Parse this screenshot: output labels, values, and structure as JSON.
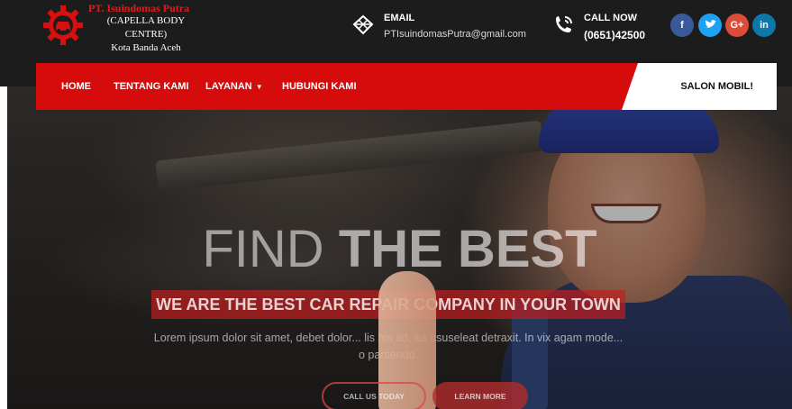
{
  "brand": {
    "name": "PT. Isuindomas Putra",
    "subtitle": "(CAPELLA BODY CENTRE)",
    "city": "Kota Banda Aceh"
  },
  "contact": {
    "email_label": "EMAIL",
    "email_value": "PTIsuindomasPutra@gmail.com",
    "phone_label": "CALL NOW",
    "phone_value": "(0651)42500"
  },
  "socials": [
    {
      "glyph": "f",
      "color": "#3b5998"
    },
    {
      "glyph": "t",
      "color": "#1da1f2"
    },
    {
      "glyph": "G+",
      "color": "#dd4b39"
    },
    {
      "glyph": "in",
      "color": "#0e76a8"
    }
  ],
  "nav": {
    "home": "HOME",
    "about": "TENTANG KAMI",
    "services": "LAYANAN",
    "contact": "HUBUNGI KAMI",
    "cta": "SALON MOBIL!"
  },
  "hero": {
    "title_light": "FIND ",
    "title_bold": "THE BEST",
    "banner": "WE ARE THE BEST CAR REPAIR COMPANY IN YOUR TOWN",
    "text": "Lorem ipsum dolor sit amet, debet dolor... lis his ad, ea ususeleat detraxit. In vix agam mode... o partiendo.",
    "btn_call": "CALL US TODAY",
    "btn_learn": "LEARN MORE"
  },
  "colors": {
    "accent": "#d60b0b",
    "header_bg": "#1c1c1c"
  }
}
